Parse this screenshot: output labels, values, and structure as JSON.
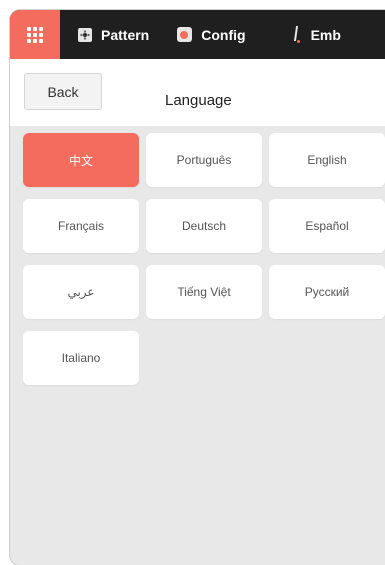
{
  "topbar": {
    "tabs": [
      {
        "label": "Pattern",
        "icon": "pattern-icon"
      },
      {
        "label": "Config",
        "icon": "config-icon"
      },
      {
        "label": "Emb",
        "icon": "embroidery-icon"
      }
    ]
  },
  "header": {
    "back_label": "Back",
    "title": "Language"
  },
  "languages": [
    {
      "label": "中文",
      "selected": true
    },
    {
      "label": "Português",
      "selected": false
    },
    {
      "label": "English",
      "selected": false
    },
    {
      "label": "Français",
      "selected": false
    },
    {
      "label": "Deutsch",
      "selected": false
    },
    {
      "label": "Español",
      "selected": false
    },
    {
      "label": "عربي",
      "selected": false
    },
    {
      "label": "Tiếng Việt",
      "selected": false
    },
    {
      "label": "Русский",
      "selected": false
    },
    {
      "label": "Italiano",
      "selected": false
    }
  ],
  "colors": {
    "accent": "#f46c5e",
    "topbar": "#1f1f1f",
    "background": "#e8e8e8"
  }
}
